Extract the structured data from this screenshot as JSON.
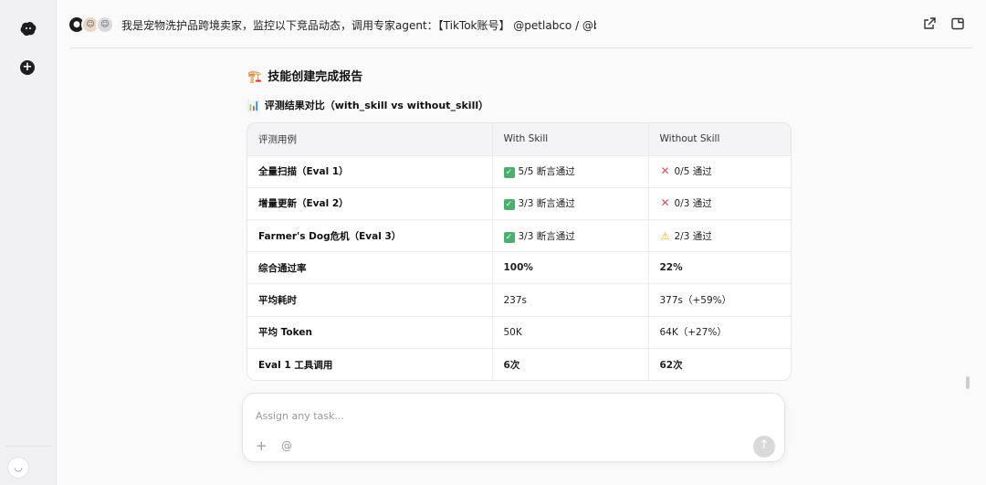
{
  "app": {
    "task_title": "我是宠物洗护品跨境卖家，监控以下竞品动态，调用专家agent：【TikTok账号】 @petlabco / @bark..."
  },
  "report": {
    "heading_emoji": "🏗️",
    "heading": "技能创建完成报告",
    "subheading_emoji": "📊",
    "subheading": "评测结果对比（with_skill vs without_skill）",
    "columns": [
      "评测用例",
      "With Skill",
      "Without Skill"
    ],
    "rows": [
      {
        "case": "全量扫描（Eval 1）",
        "with_icon": "check",
        "with": "5/5 断言通过",
        "without_icon": "cross",
        "without": "0/5 通过",
        "bold": false
      },
      {
        "case": "增量更新（Eval 2）",
        "with_icon": "check",
        "with": "3/3 断言通过",
        "without_icon": "cross",
        "without": "0/3 通过",
        "bold": false
      },
      {
        "case": "Farmer's Dog危机（Eval 3）",
        "with_icon": "check",
        "with": "3/3 断言通过",
        "without_icon": "warning",
        "without": "2/3 通过",
        "bold": false
      },
      {
        "case": "综合通过率",
        "with_icon": "",
        "with": "100%",
        "without_icon": "",
        "without": "22%",
        "bold": true
      },
      {
        "case": "平均耗时",
        "with_icon": "",
        "with": "237s",
        "without_icon": "",
        "without": "377s（+59%）",
        "bold": false
      },
      {
        "case": "平均 Token",
        "with_icon": "",
        "with": "50K",
        "without_icon": "",
        "without": "64K（+27%）",
        "bold": false
      },
      {
        "case": "Eval 1 工具调用",
        "with_icon": "",
        "with": "6次",
        "without_icon": "",
        "without": "62次",
        "bold": true
      }
    ]
  },
  "composer": {
    "placeholder": "Assign any task...",
    "plus_icon": "plus-icon",
    "mention_label": "@",
    "send_icon": "arrow-up-icon"
  },
  "colors": {
    "check": "#4caf6d",
    "cross": "#e0505d",
    "warning": "#f2a622"
  }
}
